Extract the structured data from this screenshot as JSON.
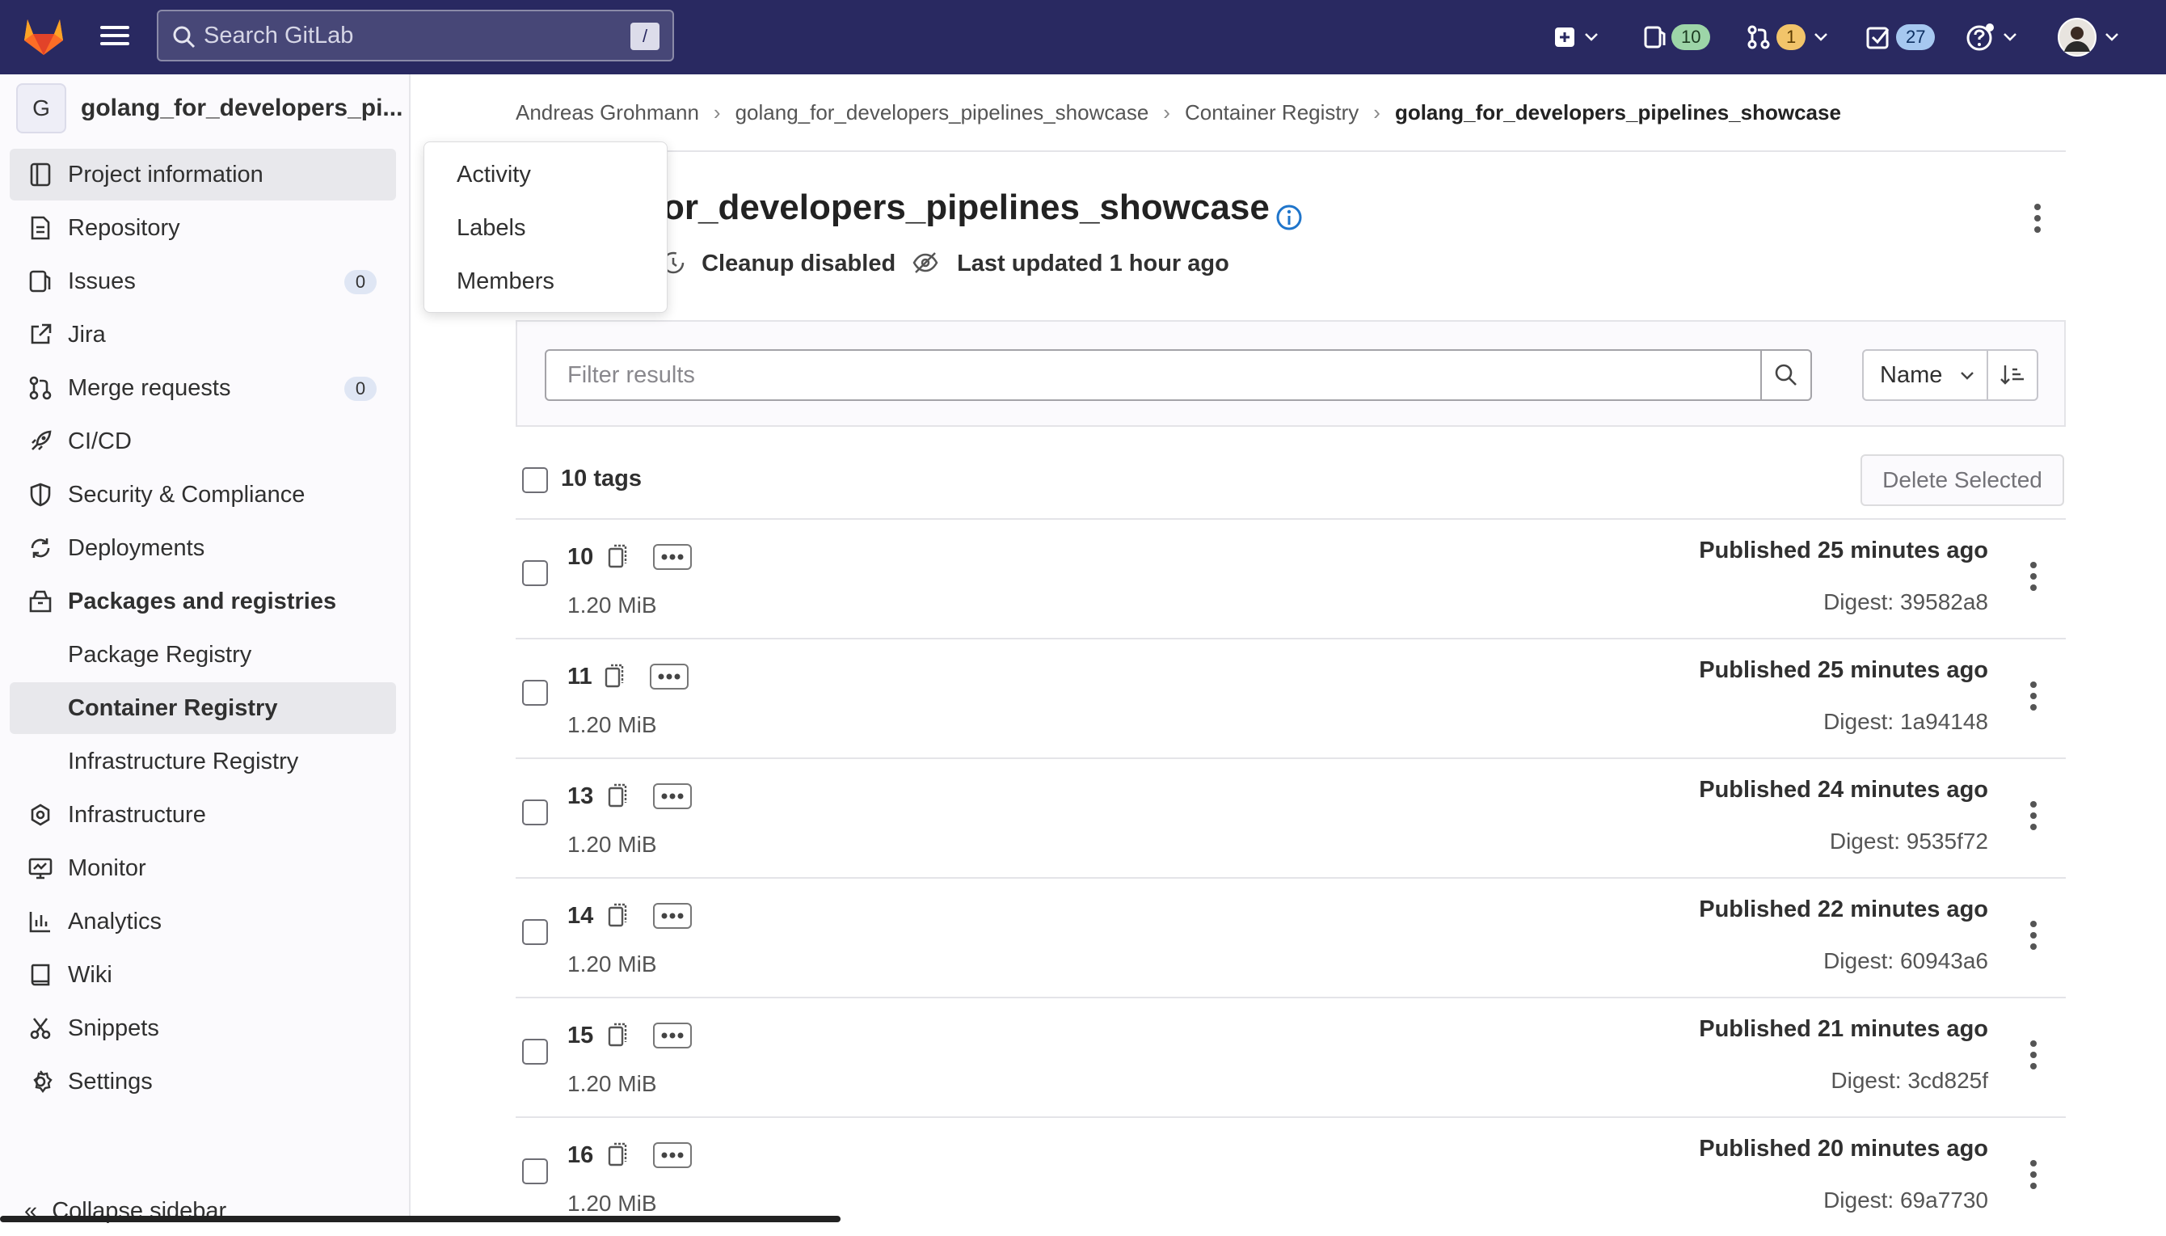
{
  "topbar": {
    "search_placeholder": "Search GitLab",
    "search_shortcut": "/",
    "issues_count": "10",
    "mr_count": "1",
    "todo_count": "27"
  },
  "sidebar": {
    "project_initial": "G",
    "project_name": "golang_for_developers_pi...",
    "items": [
      {
        "label": "Project information",
        "icon": "project-icon"
      },
      {
        "label": "Repository",
        "icon": "document-icon"
      },
      {
        "label": "Issues",
        "icon": "issues-icon",
        "badge": "0"
      },
      {
        "label": "Jira",
        "icon": "external-link-icon"
      },
      {
        "label": "Merge requests",
        "icon": "merge-request-icon",
        "badge": "0"
      },
      {
        "label": "CI/CD",
        "icon": "rocket-icon"
      },
      {
        "label": "Security & Compliance",
        "icon": "shield-icon"
      },
      {
        "label": "Deployments",
        "icon": "deployments-icon"
      },
      {
        "label": "Packages and registries",
        "icon": "package-icon"
      },
      {
        "label": "Package Registry"
      },
      {
        "label": "Container Registry"
      },
      {
        "label": "Infrastructure Registry"
      },
      {
        "label": "Infrastructure",
        "icon": "cloud-gear-icon"
      },
      {
        "label": "Monitor",
        "icon": "monitor-icon"
      },
      {
        "label": "Analytics",
        "icon": "chart-icon"
      },
      {
        "label": "Wiki",
        "icon": "book-icon"
      },
      {
        "label": "Snippets",
        "icon": "scissors-icon"
      },
      {
        "label": "Settings",
        "icon": "gear-icon"
      }
    ],
    "collapse_label": "Collapse sidebar"
  },
  "flyout": {
    "items": [
      "Activity",
      "Labels",
      "Members"
    ]
  },
  "breadcrumb": [
    "Andreas Grohmann",
    "golang_for_developers_pipelines_showcase",
    "Container Registry",
    "golang_for_developers_pipelines_showcase"
  ],
  "page": {
    "title": "or_developers_pipelines_showcase",
    "cleanup": "Cleanup disabled",
    "updated": "Last updated 1 hour ago"
  },
  "filter": {
    "placeholder": "Filter results",
    "sort_label": "Name"
  },
  "list": {
    "count_label": "10 tags",
    "delete_label": "Delete Selected",
    "tags": [
      {
        "name": "10",
        "size": "1.20 MiB",
        "published": "Published 25 minutes ago",
        "digest": "Digest: 39582a8"
      },
      {
        "name": "11",
        "size": "1.20 MiB",
        "published": "Published 25 minutes ago",
        "digest": "Digest: 1a94148"
      },
      {
        "name": "13",
        "size": "1.20 MiB",
        "published": "Published 24 minutes ago",
        "digest": "Digest: 9535f72"
      },
      {
        "name": "14",
        "size": "1.20 MiB",
        "published": "Published 22 minutes ago",
        "digest": "Digest: 60943a6"
      },
      {
        "name": "15",
        "size": "1.20 MiB",
        "published": "Published 21 minutes ago",
        "digest": "Digest: 3cd825f"
      },
      {
        "name": "16",
        "size": "1.20 MiB",
        "published": "Published 20 minutes ago",
        "digest": "Digest: 69a7730"
      }
    ]
  }
}
